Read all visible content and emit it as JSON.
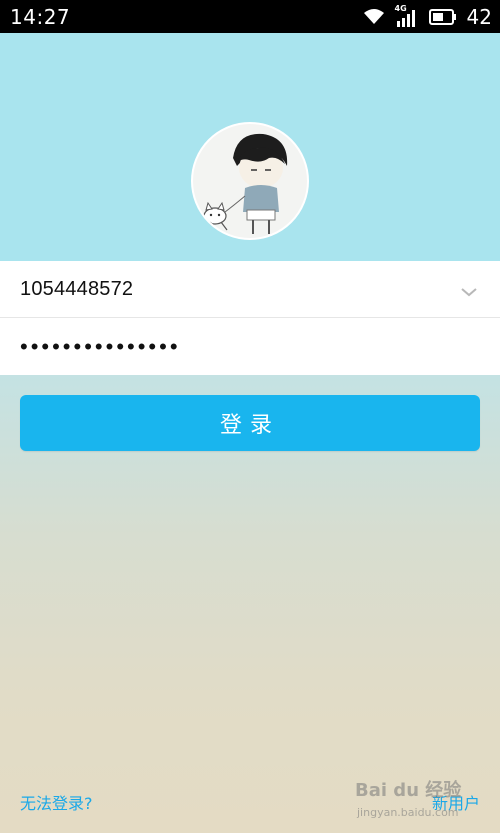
{
  "status_bar": {
    "time": "14:27",
    "network_label": "4G",
    "battery_level": "42",
    "icons": [
      "wifi-icon",
      "signal-icon",
      "battery-icon"
    ]
  },
  "profile": {
    "avatar_icon": "cartoon-boy-with-cat-avatar"
  },
  "login_form": {
    "account_value": "1054448572",
    "password_masked": "•••••••••••••••",
    "dropdown_icon": "chevron-down-icon",
    "login_button_label": "登录"
  },
  "footer": {
    "cannot_login_link": "无法登录?",
    "new_user_link": "新用户"
  },
  "watermark": {
    "text": "Bai du 经验",
    "sub": "jingyan.baidu.com"
  },
  "colors": {
    "hero_bg": "#a9e4ee",
    "button_bg": "#19b5ee",
    "link": "#1aa8e8",
    "field_bg": "#ffffff"
  }
}
